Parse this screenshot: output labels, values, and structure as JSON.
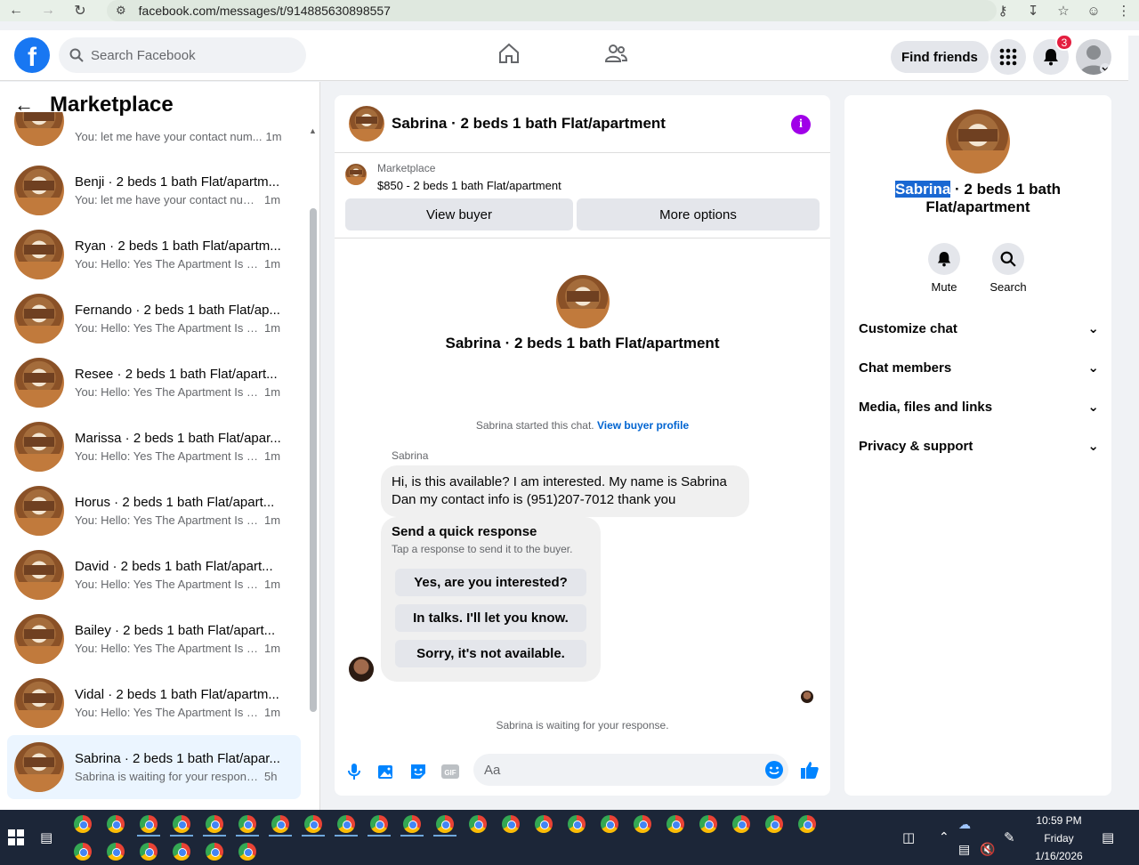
{
  "browser": {
    "url": "facebook.com/messages/t/914885630898557"
  },
  "header": {
    "search_placeholder": "Search Facebook",
    "find_friends": "Find friends",
    "notification_count": "3"
  },
  "left_panel": {
    "title": "Marketplace",
    "partial_top_snippet": "You: let me have your contact num...",
    "partial_top_time": "1m",
    "conversations": [
      {
        "name": "Benji · 2 beds 1 bath Flat/apartm...",
        "snippet": "You: let me have your contact num...",
        "time": "1m"
      },
      {
        "name": "Ryan · 2 beds 1 bath Flat/apartm...",
        "snippet": "You: Hello: Yes The Apartment Is St...",
        "time": "1m"
      },
      {
        "name": "Fernando · 2 beds 1 bath Flat/ap...",
        "snippet": "You: Hello: Yes The Apartment Is St...",
        "time": "1m"
      },
      {
        "name": "Resee · 2 beds 1 bath Flat/apart...",
        "snippet": "You: Hello: Yes The Apartment Is St...",
        "time": "1m"
      },
      {
        "name": "Marissa · 2 beds 1 bath Flat/apar...",
        "snippet": "You: Hello: Yes The Apartment Is St...",
        "time": "1m"
      },
      {
        "name": "Horus · 2 beds 1 bath Flat/apart...",
        "snippet": "You: Hello: Yes The Apartment Is St...",
        "time": "1m"
      },
      {
        "name": "David · 2 beds 1 bath Flat/apart...",
        "snippet": "You: Hello: Yes The Apartment Is St...",
        "time": "1m"
      },
      {
        "name": "Bailey · 2 beds 1 bath Flat/apart...",
        "snippet": "You: Hello: Yes The Apartment Is St...",
        "time": "1m"
      },
      {
        "name": "Vidal · 2 beds 1 bath Flat/apartm...",
        "snippet": "You: Hello: Yes The Apartment Is St...",
        "time": "1m"
      },
      {
        "name": "Sabrina · 2 beds 1 bath Flat/apar...",
        "snippet": "Sabrina is waiting for your response.",
        "time": "5h"
      }
    ]
  },
  "chat": {
    "header_title": "Sabrina · 2 beds 1 bath Flat/apartment",
    "marketplace_label": "Marketplace",
    "listing": "$850 - 2 beds 1 bath Flat/apartment",
    "view_buyer": "View buyer",
    "more_options": "More options",
    "center_title": "Sabrina · 2 beds 1 bath Flat/apartment",
    "started_text": "Sabrina started this chat.",
    "view_buyer_profile": "View buyer profile",
    "sender": "Sabrina",
    "message": "Hi, is this available? I am interested. My name is Sabrina Dan my contact info is (951)207-7012 thank you",
    "quick_title": "Send a quick response",
    "quick_sub": "Tap a response to send it to the buyer.",
    "quick_responses": [
      "Yes, are you interested?",
      "In talks. I'll let you know.",
      "Sorry, it's not available."
    ],
    "waiting": "Sabrina is waiting for your response.",
    "composer_placeholder": "Aa"
  },
  "right_panel": {
    "title_highlight": "Sabrina",
    "title_rest": " · 2 beds 1 bath Flat/apartment",
    "mute": "Mute",
    "search": "Search",
    "sections": [
      "Customize chat",
      "Chat members",
      "Media, files and links",
      "Privacy & support"
    ]
  },
  "taskbar": {
    "time": "10:59 PM",
    "day": "Friday",
    "date": "1/16/2026"
  },
  "colors": {
    "fb_blue": "#1877f2",
    "messenger_blue": "#0084ff",
    "info_purple": "#a000e8",
    "badge_red": "#e41e3f"
  }
}
